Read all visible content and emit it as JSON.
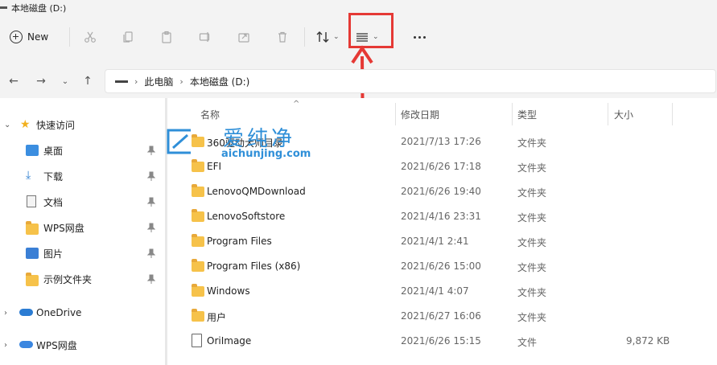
{
  "window": {
    "title": "本地磁盘 (D:)"
  },
  "toolbar": {
    "new_label": "New",
    "cut_icon": "scissors-icon",
    "copy_icon": "copy-icon",
    "paste_icon": "paste-icon",
    "rename_icon": "rename-icon",
    "share_icon": "share-icon",
    "delete_icon": "trash-icon",
    "sort_icon": "sort-arrows-icon",
    "view_icon": "view-list-icon",
    "more_icon": "more-ellipsis-icon"
  },
  "annotation": {
    "color": "#e53935"
  },
  "address": {
    "crumbs": [
      "此电脑",
      "本地磁盘 (D:)"
    ]
  },
  "sidebar": {
    "quick_access": {
      "label": "快速访问"
    },
    "pinned": [
      {
        "label": "桌面",
        "icon": "desktop-icon"
      },
      {
        "label": "下载",
        "icon": "download-icon"
      },
      {
        "label": "文档",
        "icon": "document-icon"
      },
      {
        "label": "WPS网盘",
        "icon": "folder-icon"
      },
      {
        "label": "图片",
        "icon": "picture-icon"
      },
      {
        "label": "示例文件夹",
        "icon": "folder-icon"
      }
    ],
    "onedrive": {
      "label": "OneDrive"
    },
    "wps": {
      "label": "WPS网盘"
    }
  },
  "columns": {
    "name": "名称",
    "date": "修改日期",
    "type": "类型",
    "size": "大小"
  },
  "files": [
    {
      "name": "360驱动大师目录",
      "date": "2021/7/13 17:26",
      "type": "文件夹",
      "size": "",
      "kind": "folder"
    },
    {
      "name": "EFI",
      "date": "2021/6/26 17:18",
      "type": "文件夹",
      "size": "",
      "kind": "folder"
    },
    {
      "name": "LenovoQMDownload",
      "date": "2021/6/26 19:40",
      "type": "文件夹",
      "size": "",
      "kind": "folder"
    },
    {
      "name": "LenovoSoftstore",
      "date": "2021/4/16 23:31",
      "type": "文件夹",
      "size": "",
      "kind": "folder"
    },
    {
      "name": "Program Files",
      "date": "2021/4/1 2:41",
      "type": "文件夹",
      "size": "",
      "kind": "folder"
    },
    {
      "name": "Program Files (x86)",
      "date": "2021/6/26 15:00",
      "type": "文件夹",
      "size": "",
      "kind": "folder"
    },
    {
      "name": "Windows",
      "date": "2021/4/1 4:07",
      "type": "文件夹",
      "size": "",
      "kind": "folder"
    },
    {
      "name": "用户",
      "date": "2021/6/27 16:06",
      "type": "文件夹",
      "size": "",
      "kind": "folder"
    },
    {
      "name": "OriImage",
      "date": "2021/6/26 15:15",
      "type": "文件",
      "size": "9,872 KB",
      "kind": "file"
    }
  ],
  "watermark": {
    "text": "爱纯净",
    "url": "aichunjing.com"
  }
}
